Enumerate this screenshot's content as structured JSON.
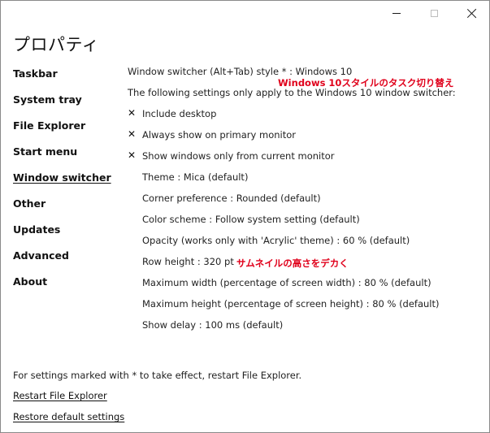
{
  "window": {
    "title": "プロパティ"
  },
  "caption_buttons": {
    "minimize_icon": "minimize-icon",
    "maximize_icon": "maximize-icon",
    "close_icon": "close-icon"
  },
  "sidebar": {
    "items": [
      {
        "label": "Taskbar"
      },
      {
        "label": "System tray"
      },
      {
        "label": "File Explorer"
      },
      {
        "label": "Start menu"
      },
      {
        "label": "Window switcher",
        "active": true
      },
      {
        "label": "Other"
      },
      {
        "label": "Updates"
      },
      {
        "label": "Advanced"
      },
      {
        "label": "About"
      }
    ]
  },
  "main": {
    "style_setting": "Window switcher (Alt+Tab) style * : Windows 10",
    "annotation_style": "Windows 10スタイルのタスク切り替え",
    "info": "The following settings only apply to the Windows 10 window switcher:",
    "check_glyph": "✕",
    "checkboxes": [
      {
        "label": "Include desktop"
      },
      {
        "label": "Always show on primary monitor"
      },
      {
        "label": "Show windows only from current monitor"
      }
    ],
    "options": [
      {
        "label": "Theme : Mica (default)"
      },
      {
        "label": "Corner preference : Rounded (default)"
      },
      {
        "label": "Color scheme : Follow system setting (default)"
      },
      {
        "label": "Opacity (works only with 'Acrylic' theme) : 60 % (default)"
      },
      {
        "label": "Row height : 320 pt"
      },
      {
        "label": "Maximum width (percentage of screen width) : 80 % (default)"
      },
      {
        "label": "Maximum height (percentage of screen height) : 80 % (default)"
      },
      {
        "label": "Show delay : 100 ms (default)"
      }
    ],
    "annotation_row_height": "サムネイルの高さをデカく"
  },
  "footer": {
    "note": "For settings marked with * to take effect, restart File Explorer.",
    "restart_link": "Restart File Explorer",
    "restore_link": "Restore default settings"
  },
  "colors": {
    "annotation": "#e0001b",
    "text": "#222222",
    "background": "#ffffff"
  }
}
